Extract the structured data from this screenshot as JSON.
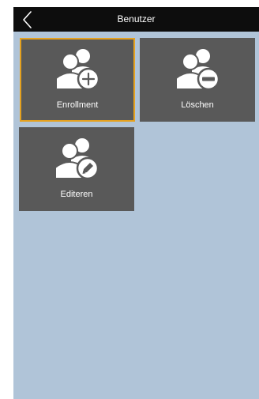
{
  "header": {
    "title": "Benutzer",
    "back_icon": "chevron-left-icon"
  },
  "tiles": [
    {
      "label": "Enrollment",
      "icon": "users-add-icon",
      "selected": true
    },
    {
      "label": "Löschen",
      "icon": "users-remove-icon",
      "selected": false
    },
    {
      "label": "Editeren",
      "icon": "users-edit-icon",
      "selected": false
    }
  ],
  "colors": {
    "header_bg": "#0d0d0d",
    "screen_bg": "#b0c4d8",
    "tile_bg": "#595959",
    "selection_border": "#e5a11f",
    "text": "#ffffff"
  }
}
